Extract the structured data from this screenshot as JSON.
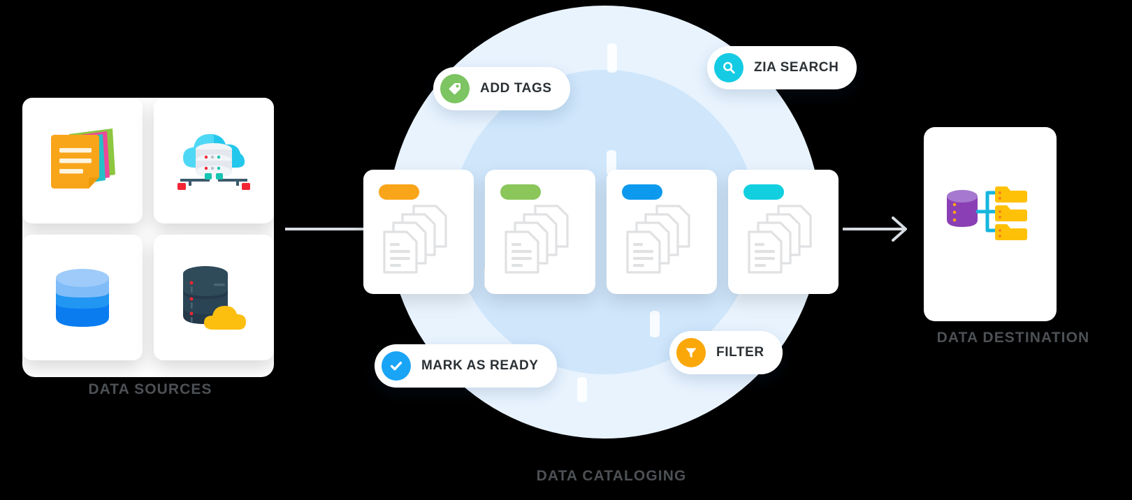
{
  "background_color": "#000000",
  "labels": {
    "sources": "DATA SOURCES",
    "cataloging": "DATA CATALOGING",
    "destination": "DATA DESTINATION",
    "label_color": "#4d5155"
  },
  "sources": {
    "cards": [
      {
        "name": "notes-documents-icon",
        "colors": {
          "front": "#f9a51a",
          "sheet_green": "#8dc63f",
          "sheet_pink": "#ec4899",
          "sheet_teal": "#26bfc7"
        }
      },
      {
        "name": "cloud-database-icon",
        "colors": {
          "cloud": "#4fd8f5",
          "cloud_dark": "#23c7ec",
          "drum": "#e4e8ee",
          "cable": "#3d5a6c",
          "red": "#f42534",
          "teal": "#16c4b2"
        }
      },
      {
        "name": "database-cylinder-icon",
        "colors": {
          "top": "#9ecbfa",
          "mid": "#2196f3",
          "bottom": "#0a7cf0"
        }
      },
      {
        "name": "server-cloud-icon",
        "colors": {
          "server": "#2f4a59",
          "server_dark": "#24394a",
          "led": "#f42534",
          "cloud": "#fcbf10"
        }
      }
    ]
  },
  "cataloging": {
    "circle_outer_color": "#e8f3fe",
    "circle_inner_color": "#cfe6fb",
    "doc_cards": [
      {
        "tag_label_color": "#f9a51a",
        "tag_name": "tag-orange",
        "docs": 4
      },
      {
        "tag_label_color": "#8ac65a",
        "tag_name": "tag-green",
        "docs": 4
      },
      {
        "tag_label_color": "#0d9aee",
        "tag_name": "tag-blue",
        "docs": 4
      },
      {
        "tag_label_color": "#12cfe0",
        "tag_name": "tag-cyan",
        "docs": 4
      }
    ],
    "doc_outline_color": "#e0e1e3",
    "pills": [
      {
        "id": "add-tags",
        "label": "ADD TAGS",
        "icon": "tag-icon",
        "badge_color": "#7dc462"
      },
      {
        "id": "zia-search",
        "label": "ZIA SEARCH",
        "icon": "search-icon",
        "badge_color": "#14cbe3"
      },
      {
        "id": "mark-as-ready",
        "label": "MARK AS READY",
        "icon": "check-circle-icon",
        "badge_color": "#1aa4f5"
      },
      {
        "id": "filter",
        "label": "FILTER",
        "icon": "funnel-icon",
        "badge_color": "#faa70a"
      }
    ]
  },
  "destination": {
    "icon": "database-to-folders-icon",
    "colors": {
      "db_top": "#a678cf",
      "db_body": "#8b3fb5",
      "db_dot": "#f9a51a",
      "link": "#16b6dd",
      "folder": "#ffc107",
      "folder_tab": "#fcb200",
      "folder_dot": "#f47b20"
    }
  },
  "connectors": {
    "left_arrow": {
      "name": "arrow-sources-to-cataloging",
      "color": "#d7dce2"
    },
    "right_arrow": {
      "name": "arrow-cataloging-to-destination",
      "color": "#d7dce2"
    }
  }
}
